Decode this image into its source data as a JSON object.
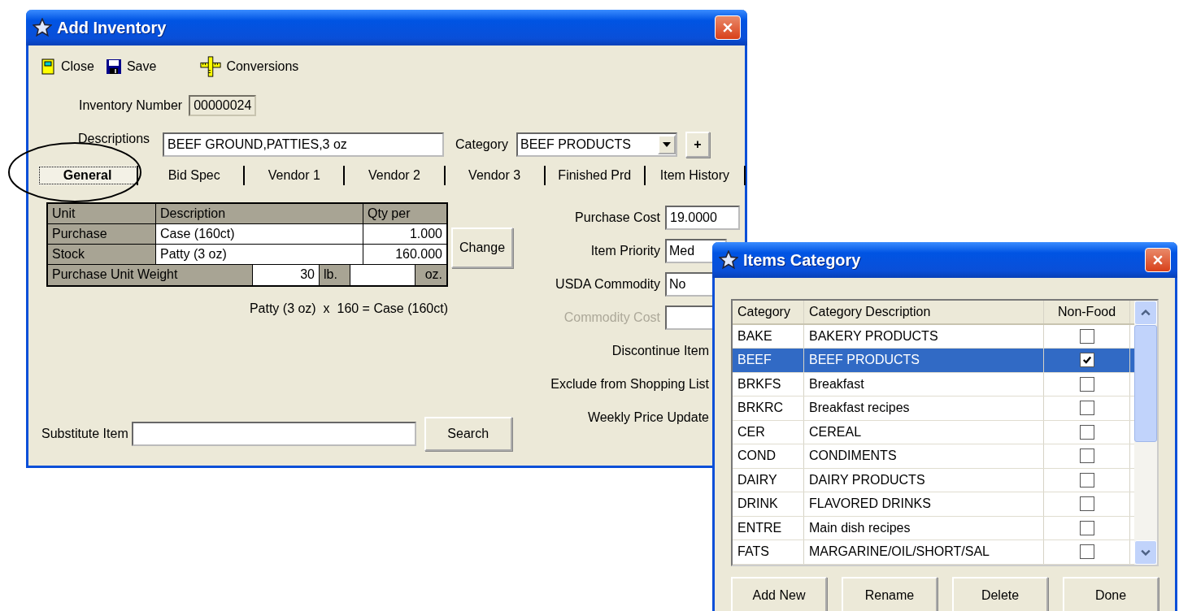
{
  "inventory_window": {
    "title": "Add Inventory",
    "toolbar": [
      {
        "label": "Close",
        "kind": "close"
      },
      {
        "label": "Save",
        "kind": "save"
      },
      {
        "label": "Conversions",
        "kind": "conversions"
      }
    ],
    "inventory_number": {
      "label": "Inventory Number",
      "value": "00000024"
    },
    "description": {
      "label": "Descriptions",
      "value": "BEEF GROUND,PATTIES,3 oz"
    },
    "category": {
      "label": "Category",
      "value": "BEEF PRODUCTS"
    },
    "add_category_button": "+",
    "tabs": [
      {
        "label": "General",
        "selected": true
      },
      {
        "label": "Bid Spec",
        "selected": false
      },
      {
        "label": "Vendor 1",
        "selected": false
      },
      {
        "label": "Vendor 2",
        "selected": false
      },
      {
        "label": "Vendor 3",
        "selected": false
      },
      {
        "label": "Finished Prd",
        "selected": false
      },
      {
        "label": "Item History",
        "selected": false
      }
    ],
    "unit_table": {
      "columns": [
        "Unit",
        "Description",
        "Qty per"
      ],
      "rows": [
        {
          "unit": "Purchase",
          "description": "Case (160ct)",
          "qty": "1.000"
        },
        {
          "unit": "Stock",
          "description": "Patty (3 oz)",
          "qty": "160.000"
        }
      ],
      "weight": {
        "label": "Purchase Unit Weight",
        "lb_value": "30",
        "lb_unit": "lb.",
        "oz_unit": "oz."
      }
    },
    "change_button": "Change",
    "formula": "Patty (3 oz)  x  160 = Case (160ct)",
    "purchase_cost": {
      "label": "Purchase Cost",
      "value": "19.0000"
    },
    "item_priority": {
      "label": "Item Priority",
      "value": "Med"
    },
    "usda_commodity": {
      "label": "USDA Commodity",
      "value": "No"
    },
    "commodity_cost": {
      "label": "Commodity Cost",
      "disabled": true
    },
    "flags": [
      {
        "label": "Discontinue Item"
      },
      {
        "label": "Exclude from Shopping List"
      },
      {
        "label": "Weekly Price Update"
      }
    ],
    "substitute_item": {
      "label": "Substitute Item"
    },
    "search_button": "Search"
  },
  "category_window": {
    "title": "Items Category",
    "columns": [
      "Category",
      "Category Description",
      "Non-Food"
    ],
    "rows": [
      {
        "code": "BAKE",
        "description": "BAKERY PRODUCTS",
        "non_food": false,
        "selected": false
      },
      {
        "code": "BEEF",
        "description": "BEEF PRODUCTS",
        "non_food": true,
        "selected": true
      },
      {
        "code": "BRKFS",
        "description": "Breakfast",
        "non_food": false,
        "selected": false
      },
      {
        "code": "BRKRC",
        "description": "Breakfast recipes",
        "non_food": false,
        "selected": false
      },
      {
        "code": "CER",
        "description": "CEREAL",
        "non_food": false,
        "selected": false
      },
      {
        "code": "COND",
        "description": "CONDIMENTS",
        "non_food": false,
        "selected": false
      },
      {
        "code": "DAIRY",
        "description": "DAIRY PRODUCTS",
        "non_food": false,
        "selected": false
      },
      {
        "code": "DRINK",
        "description": "FLAVORED DRINKS",
        "non_food": false,
        "selected": false
      },
      {
        "code": "ENTRE",
        "description": "Main dish recipes",
        "non_food": false,
        "selected": false
      },
      {
        "code": "FATS",
        "description": "MARGARINE/OIL/SHORT/SAL",
        "non_food": false,
        "selected": false
      }
    ],
    "buttons": [
      "Add New",
      "Rename",
      "Delete",
      "Done"
    ]
  }
}
